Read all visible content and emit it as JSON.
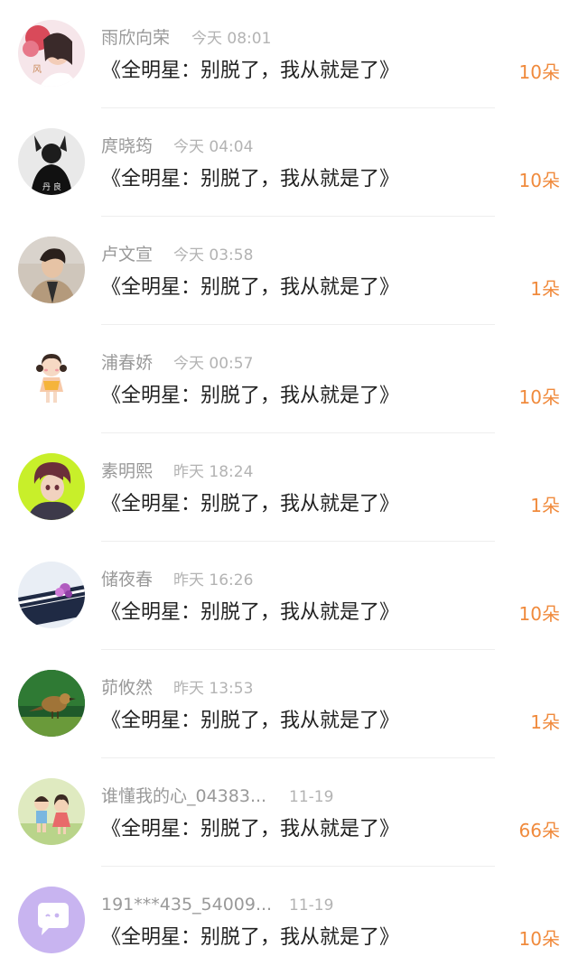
{
  "records": [
    {
      "name": "雨欣向荣",
      "time": "今天 08:01",
      "title": "《全明星：别脱了，我从就是了》",
      "gift": "10朵",
      "avatar": "girl-flowers-avatar"
    },
    {
      "name": "庹晓筠",
      "time": "今天 04:04",
      "title": "《全明星：别脱了，我从就是了》",
      "gift": "10朵",
      "avatar": "dark-silhouette-avatar"
    },
    {
      "name": "卢文宣",
      "time": "今天 03:58",
      "title": "《全明星：别脱了，我从就是了》",
      "gift": "1朵",
      "avatar": "young-man-avatar"
    },
    {
      "name": "浦春娇",
      "time": "今天 00:57",
      "title": "《全明星：别脱了，我从就是了》",
      "gift": "10朵",
      "avatar": "cartoon-girl-avatar"
    },
    {
      "name": "素明熙",
      "time": "昨天 18:24",
      "title": "《全明星：别脱了，我从就是了》",
      "gift": "1朵",
      "avatar": "anime-boy-avatar"
    },
    {
      "name": "储夜春",
      "time": "昨天 16:26",
      "title": "《全明星：别脱了，我从就是了》",
      "gift": "10朵",
      "avatar": "piano-flower-avatar"
    },
    {
      "name": "茆攸然",
      "time": "昨天 13:53",
      "title": "《全明星：别脱了，我从就是了》",
      "gift": "1朵",
      "avatar": "bird-avatar"
    },
    {
      "name": "谁懂我的心_04383...",
      "time": "11-19",
      "title": "《全明星：别脱了，我从就是了》",
      "gift": "66朵",
      "avatar": "cartoon-kids-avatar"
    },
    {
      "name": "191***435_54009...",
      "time": "11-19",
      "title": "《全明星：别脱了，我从就是了》",
      "gift": "10朵",
      "avatar": "chat-bubble-avatar"
    }
  ],
  "colors": {
    "gift": "#f08a3c",
    "name": "#999999",
    "time": "#b3b3b3",
    "title": "#222222"
  }
}
